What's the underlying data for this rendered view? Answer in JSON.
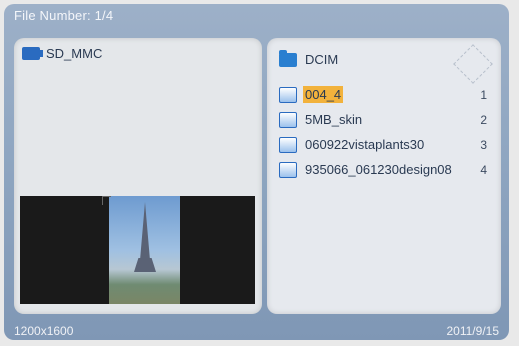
{
  "header": {
    "file_number": "File Number: 1/4"
  },
  "left_panel": {
    "device_label": "SD_MMC"
  },
  "right_panel": {
    "folder_label": "DCIM",
    "files": [
      {
        "name": "004_4",
        "index": "1",
        "selected": true
      },
      {
        "name": "5MB_skin",
        "index": "2",
        "selected": false
      },
      {
        "name": "060922vistaplants30",
        "index": "3",
        "selected": false
      },
      {
        "name": "935066_061230design08",
        "index": "4",
        "selected": false
      }
    ]
  },
  "status": {
    "resolution": "1200x1600",
    "date": "2011/9/15"
  },
  "colors": {
    "selection": "#f2b23c",
    "accent": "#2a6bc0"
  }
}
